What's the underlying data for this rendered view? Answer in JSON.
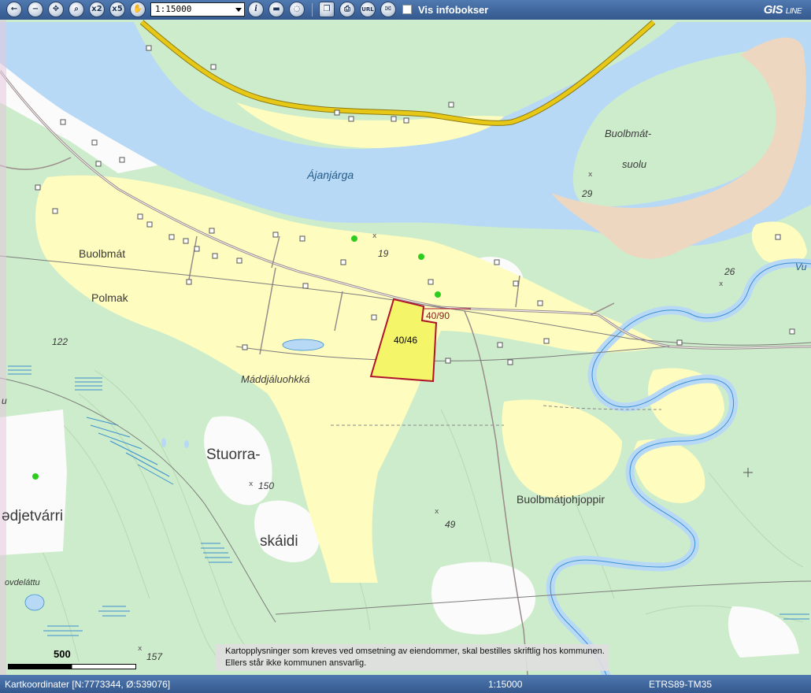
{
  "toolbar": {
    "buttons": [
      {
        "name": "back-button",
        "icon": "arrow-left-icon",
        "glyph": "←"
      },
      {
        "name": "zoom-out-button",
        "icon": "zoom-out-icon",
        "glyph": "−"
      },
      {
        "name": "pan-all-button",
        "icon": "move-arrows-icon",
        "glyph": "✥"
      },
      {
        "name": "zoom-in-button",
        "icon": "magnifier-icon",
        "glyph": "⌕"
      },
      {
        "name": "zoom-x2-button",
        "icon": "zoom-x2-icon",
        "glyph": "x2"
      },
      {
        "name": "zoom-x5-button",
        "icon": "zoom-x5-icon",
        "glyph": "x5"
      },
      {
        "name": "pan-hand-button",
        "icon": "hand-icon",
        "glyph": "✋"
      }
    ],
    "scale_value": "1:15000",
    "tools": [
      {
        "name": "info-button",
        "icon": "info-icon",
        "glyph": "i"
      },
      {
        "name": "measure-button",
        "icon": "ruler-icon",
        "glyph": "▬"
      },
      {
        "name": "area-button",
        "icon": "area-icon",
        "glyph": "◌"
      },
      {
        "name": "copy-button",
        "icon": "copy-icon",
        "glyph": "❐"
      },
      {
        "name": "print-button",
        "icon": "printer-icon",
        "glyph": "⎙"
      },
      {
        "name": "url-button",
        "icon": "url-icon",
        "glyph": "URL"
      },
      {
        "name": "email-button",
        "icon": "envelope-icon",
        "glyph": "✉"
      }
    ],
    "infobox_label": "Vis infobokser",
    "brand_main": "GIS",
    "brand_sub": "LINE"
  },
  "map": {
    "labels": {
      "river": "Ájanjárga",
      "island_1": "Buolbmát-",
      "island_2": "suolu",
      "village_1": "Buolbmát",
      "village_2": "Polmak",
      "field": "Máddjáluohkká",
      "hill_1": "Stuorra-",
      "hill_2": "skáidi",
      "hill_west": "ədjetvárri",
      "creek": "Buolbmátjohjoppir",
      "valley": "ovdeláttu",
      "edge_vu": "Vu",
      "edge_u": "u"
    },
    "elevations": {
      "e19": "19",
      "e29": "29",
      "e26": "26",
      "e122": "122",
      "e150": "150",
      "e49": "49",
      "e157": "157"
    },
    "parcels": {
      "selected": "40/46",
      "neighbor": "40/90"
    },
    "colors": {
      "water": "#b7d9f5",
      "forest": "#cdeccb",
      "farmland": "#fefcbf",
      "sand": "#eed7c1",
      "road": "#e8c817",
      "selected_fill": "#f5f56a",
      "selected_border": "#b0142c"
    }
  },
  "scalebar": {
    "label": "500 m"
  },
  "disclaimer": {
    "line1": "Kartopplysninger som kreves ved omsetning av eiendommer, skal bestilles skriftlig hos kommunen.",
    "line2": "Ellers står ikke kommunen ansvarlig."
  },
  "status": {
    "coords": "Kartkoordinater [N:7773344, Ø:539076]",
    "scale": "1:15000",
    "crs": "ETRS89-TM35"
  }
}
